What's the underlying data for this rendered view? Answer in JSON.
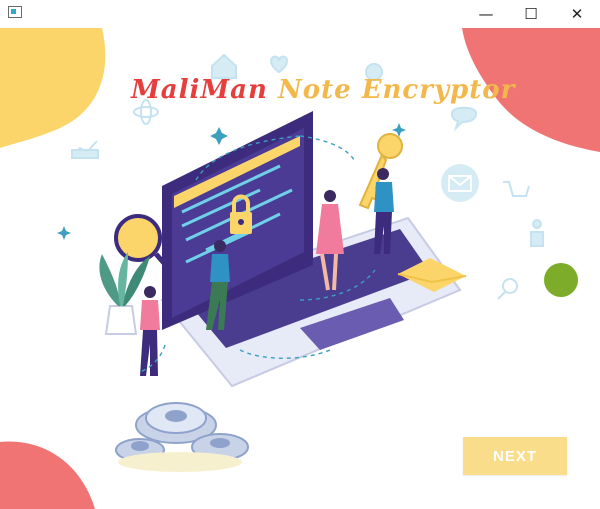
{
  "window": {
    "minimize_glyph": "—",
    "maximize_glyph": "☐",
    "close_glyph": "✕"
  },
  "hero": {
    "title_part_1": "MaliMan",
    "title_part_2": "Note Encryptor"
  },
  "actions": {
    "next_label": "NEXT"
  },
  "colors": {
    "yellow_blob": "#fcd56a",
    "coral_blob": "#f07474",
    "next_button": "#fadd8a",
    "laptop_dark": "#3d2c7d",
    "accent_blue": "#d6ecf5"
  }
}
